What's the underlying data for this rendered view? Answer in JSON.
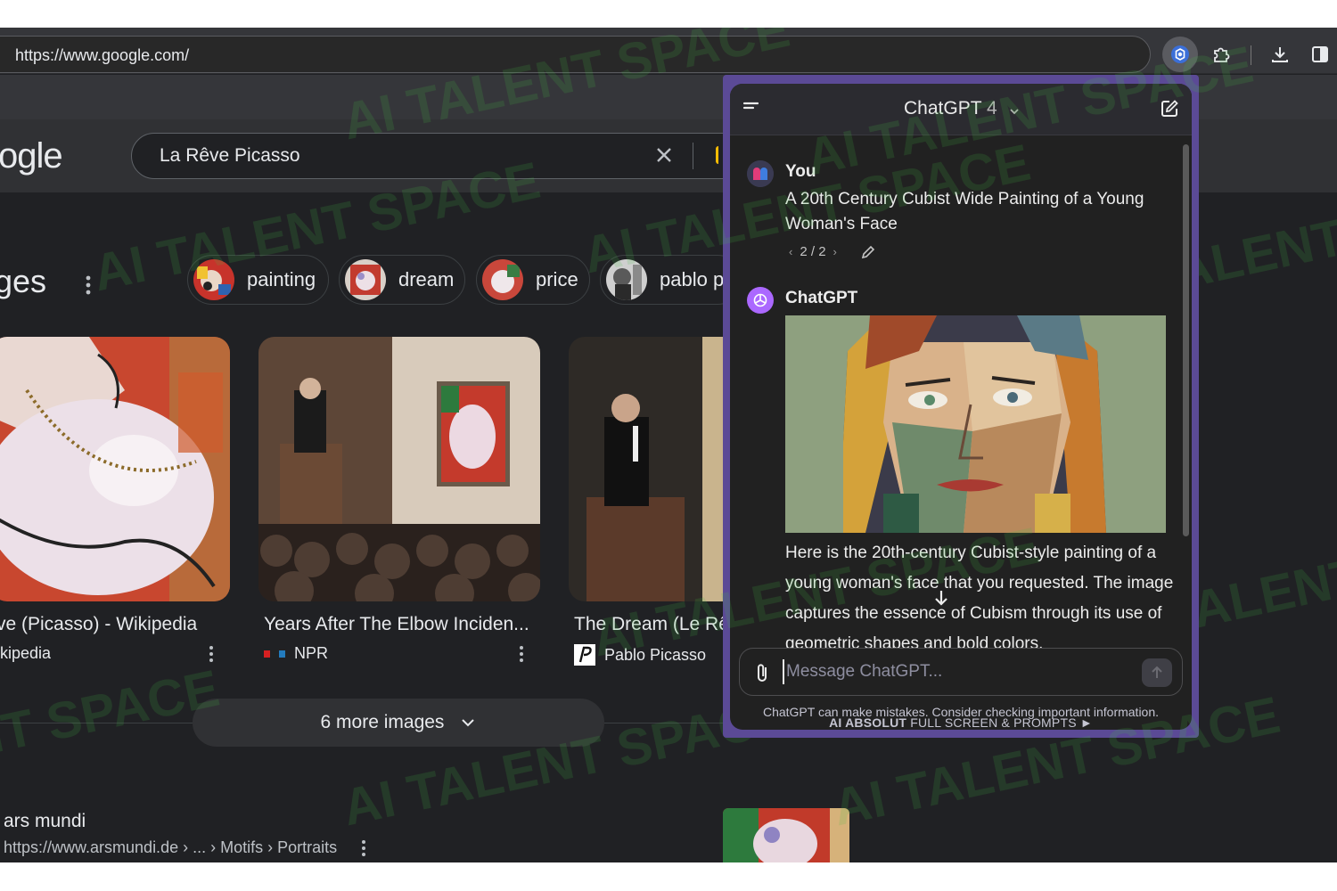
{
  "browser": {
    "url": "https://www.google.com/"
  },
  "google": {
    "logo_fragment": "ogle",
    "query": "La Rêve Picasso",
    "images_heading": "ges",
    "chips": [
      {
        "label": "painting"
      },
      {
        "label": "dream"
      },
      {
        "label": "price"
      },
      {
        "label": "pablo p"
      }
    ],
    "results": [
      {
        "title": "ve (Picasso) - Wikipedia",
        "source": "ikipedia"
      },
      {
        "title": "Years After The Elbow Inciden...",
        "source": "NPR",
        "source_logo": "npr"
      },
      {
        "title": "The Dream (Le Rê",
        "source": "Pablo Picasso"
      }
    ],
    "more_images": "6 more images",
    "site": {
      "name": "ars mundi",
      "url": "https://www.arsmundi.de › ... › Motifs › Portraits"
    }
  },
  "chatgpt": {
    "title": "ChatGPT",
    "version": "4",
    "user_name": "You",
    "user_message": "A 20th Century Cubist Wide Painting of a Young Woman's Face",
    "pager": "2 / 2",
    "assistant_name": "ChatGPT",
    "assistant_message": "Here is the 20th-century Cubist-style painting of a young woman's face that you requested. The image captures the essence of Cubism through its use of geometric shapes and bold colors.",
    "input_placeholder": "Message ChatGPT...",
    "disclaimer": "ChatGPT can make mistakes. Consider checking important information.",
    "promo_bold": "AI ABSOLUT",
    "promo_rest": "FULL SCREEN & PROMPTS ►"
  },
  "watermark": {
    "text": "AI TALENT SPACE",
    "color": "#46be46"
  },
  "colors": {
    "page_bg": "#202124",
    "panel_border": "#5b4a96",
    "panel_bg": "#212121",
    "gpt_avatar": "#ab68ff"
  }
}
